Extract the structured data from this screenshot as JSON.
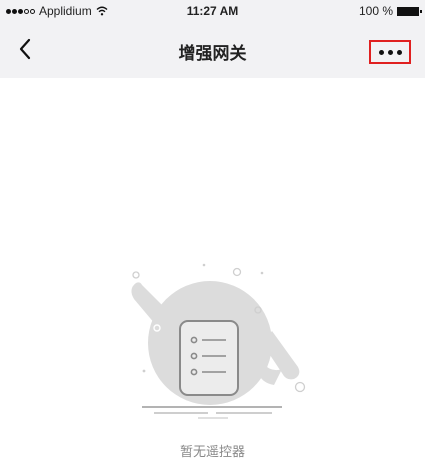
{
  "status_bar": {
    "carrier": "Applidium",
    "time": "11:27 AM",
    "battery": "100 %",
    "icons": [
      "signal-dots-icon",
      "wifi-icon",
      "battery-icon"
    ]
  },
  "nav": {
    "title": "增强网关",
    "back_icon": "chevron-left-icon",
    "more_icon": "more-horizontal-icon"
  },
  "empty_state": {
    "illustration": "remote-list-icon",
    "message": "暂无遥控器"
  },
  "colors": {
    "bar_bg": "#f2f2f4",
    "highlight_border": "#e02020",
    "illustration_gray": "#d9d9d9",
    "muted_text": "#888888"
  }
}
